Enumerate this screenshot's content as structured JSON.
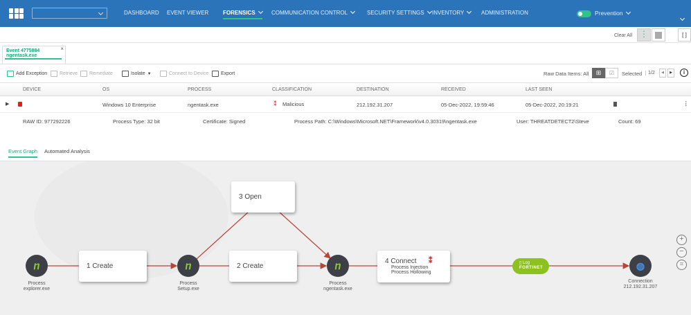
{
  "nav": {
    "items": [
      "DASHBOARD",
      "EVENT VIEWER",
      "FORENSICS",
      "COMMUNICATION CONTROL",
      "SECURITY SETTINGS",
      "INVENTORY",
      "ADMINISTRATION"
    ],
    "mode": "Prevention"
  },
  "topbar": {
    "clear_all": "Clear All"
  },
  "event_tab": {
    "title": "Event 4775884",
    "process": "ngentask.exe",
    "close": "×"
  },
  "toolbar": {
    "add_exception": "Add Exception",
    "retrieve": "Retrieve",
    "remediate": "Remediate",
    "isolate": "Isolate",
    "connect": "Connect to Device",
    "export": "Export",
    "raw_items": "Raw Data Items: All",
    "selected": "Selected",
    "page": "1/2"
  },
  "table": {
    "headers": [
      "DEVICE",
      "OS",
      "PROCESS",
      "CLASSIFICATION",
      "DESTINATION",
      "RECEIVED",
      "LAST SEEN"
    ],
    "row": {
      "os": "Windows 10 Enterprise",
      "process": "ngentask.exe",
      "classification": "Malicious",
      "destination": "212.192.31.207",
      "received": "05-Dec-2022, 19:59:46",
      "last_seen": "05-Dec-2022, 20:19:21"
    },
    "details": {
      "raw_id": "RAW ID: 977292226",
      "process_type": "Process Type: 32 bit",
      "certificate": "Certificate: Signed",
      "process_path": "Process Path: C:\\Windows\\Microsoft.NET\\Framework\\v4.0.30319\\ngentask.exe",
      "user": "User: THREATDETECT2\\Steve",
      "count": "Count: 69"
    }
  },
  "subtabs": {
    "event_graph": "Event Graph",
    "automated_analysis": "Automated Analysis"
  },
  "graph": {
    "nodes": [
      {
        "type": "Process",
        "name": "explorer.exe"
      },
      {
        "type": "Process",
        "name": "Setup.exe"
      },
      {
        "type": "Process",
        "name": "ngentask.exe"
      },
      {
        "type": "Connection",
        "name": "212.192.31.207"
      }
    ],
    "actions": {
      "a1": "1 Create",
      "a2": "2 Create",
      "a3": "3 Open",
      "a4": "4 Connect",
      "a4_sub1": "Process Injection",
      "a4_sub2": "Process Hollowing"
    },
    "log": {
      "label": "Log",
      "brand": "FORTINET"
    }
  },
  "colors": {
    "nav": "#2b74b9",
    "accent": "#2fc28d",
    "edge": "#b5473a",
    "malicious": "#e02020"
  }
}
